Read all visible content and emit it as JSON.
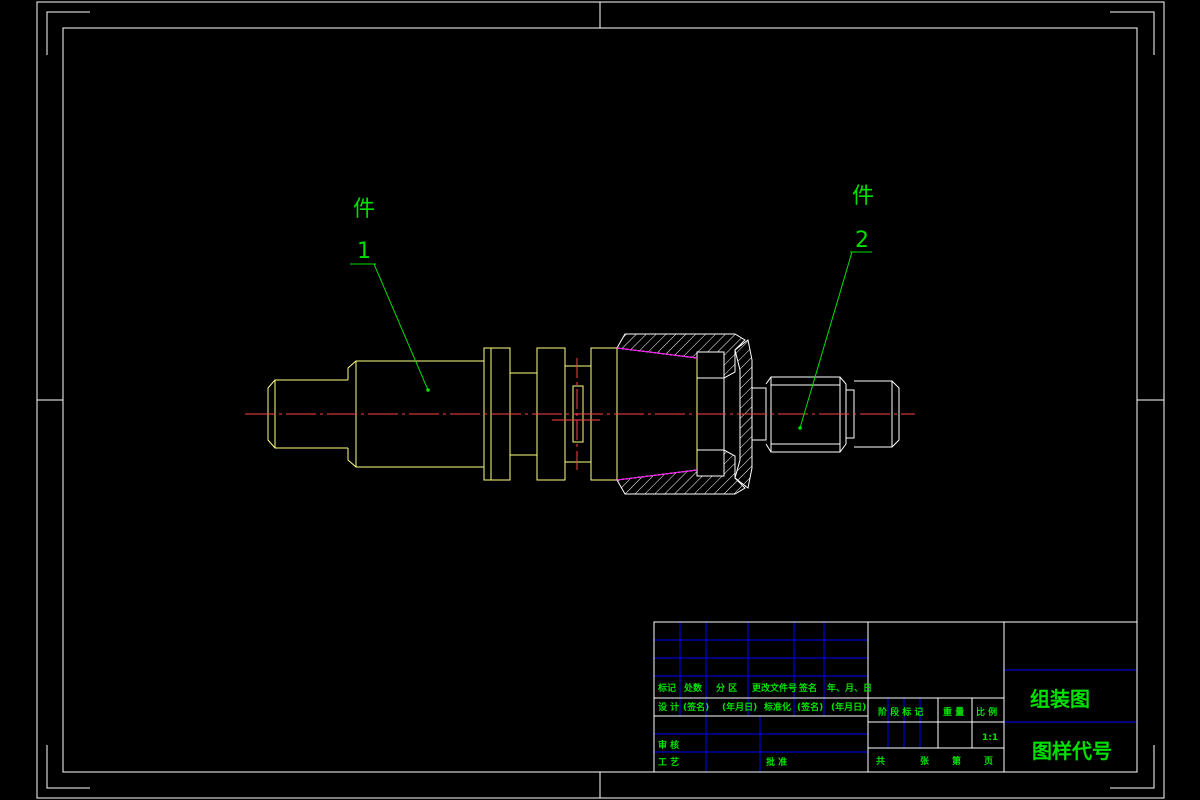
{
  "parts": {
    "p1": {
      "label": "件",
      "number": "1"
    },
    "p2": {
      "label": "件",
      "number": "2"
    }
  },
  "title_block": {
    "header_row": [
      "标记",
      "处数",
      "分 区",
      "更改文件号",
      "签名",
      "年、月、日"
    ],
    "design_row": [
      "设 计",
      "(签名)",
      "(年月日)",
      "标准化",
      "(签名)",
      "(年月日)"
    ],
    "stage_headers": [
      "阶 段 标 记",
      "重 量",
      "比 例"
    ],
    "scale": "1:1",
    "review_label": "审 核",
    "process_label": "工 艺",
    "approve_label": "批 准",
    "sheet_info": [
      "共",
      "张",
      "第",
      "页"
    ],
    "drawing_name": "组装图",
    "drawing_code": "图样代号"
  },
  "colors": {
    "background": "#000000",
    "frame": "#ffffff",
    "outline": "#ffff80",
    "centerline": "#ff4040",
    "leader": "#00e000",
    "annotation": "#00e000",
    "grid": "#0000ff",
    "taper": "#ff00ff"
  }
}
